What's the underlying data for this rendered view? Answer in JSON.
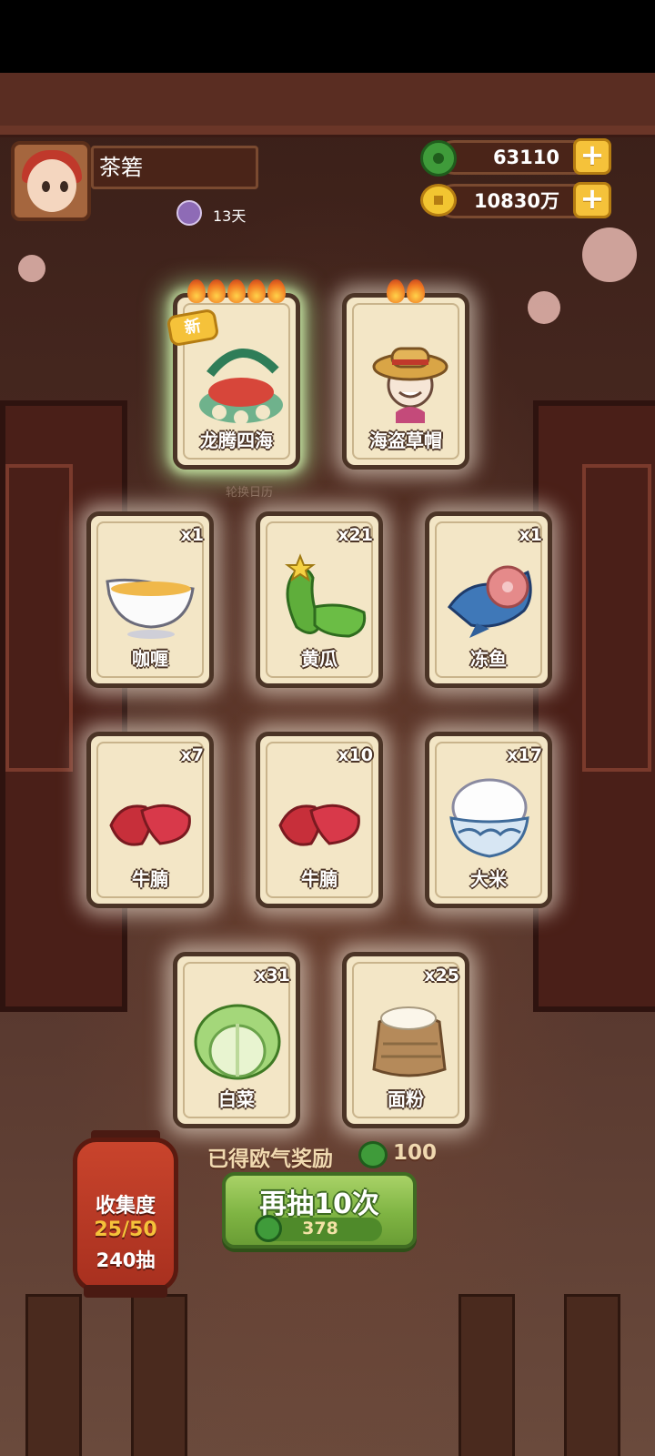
{
  "player": {
    "name": "茶箬",
    "days_label": "13天"
  },
  "resources": {
    "jade": "63110",
    "coins": "10830万",
    "plus_symbol": "+"
  },
  "featured_cards": [
    {
      "label": "龙腾四海",
      "badge": "新",
      "flames": 5
    },
    {
      "label": "海盗草帽",
      "flames": 2
    }
  ],
  "hint_text": "轮换日历",
  "cards": [
    {
      "label": "咖喱",
      "count": "x1"
    },
    {
      "label": "黄瓜",
      "count": "x21"
    },
    {
      "label": "冻鱼",
      "count": "x1"
    },
    {
      "label": "牛腩",
      "count": "x7"
    },
    {
      "label": "牛腩",
      "count": "x10"
    },
    {
      "label": "大米",
      "count": "x17"
    },
    {
      "label": "白菜",
      "count": "x31"
    },
    {
      "label": "面粉",
      "count": "x25"
    }
  ],
  "reward": {
    "label": "已得欧气奖励",
    "value": "100"
  },
  "draw_button": {
    "label": "再抽10次",
    "cost": "378"
  },
  "collection": {
    "title": "收集度",
    "progress": "25/50",
    "draws": "240抽"
  }
}
